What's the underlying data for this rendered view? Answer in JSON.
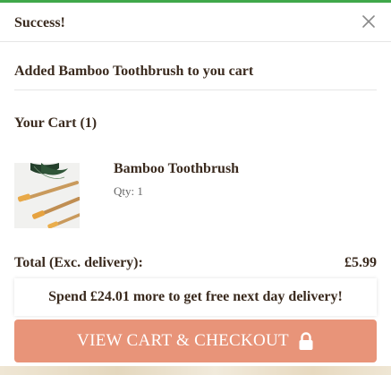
{
  "header": {
    "title": "Success!",
    "close_icon": "close-icon"
  },
  "message": "Added Bamboo Toothbrush to you cart",
  "cart": {
    "heading": "Your Cart (1)",
    "items": [
      {
        "name": "Bamboo Toothbrush",
        "qty": "Qty: 1",
        "image_icon": "bamboo-toothbrush-image"
      }
    ]
  },
  "totals": {
    "label": "Total (Exc. delivery):",
    "value": "£5.99"
  },
  "delivery_notice": "Spend £24.01 more to get free next day delivery!",
  "checkout": {
    "label": "VIEW CART & CHECKOUT",
    "icon": "lock-icon"
  },
  "colors": {
    "success_bar": "#3fa84a",
    "button": "#e89479",
    "text": "#3a2a1e"
  }
}
